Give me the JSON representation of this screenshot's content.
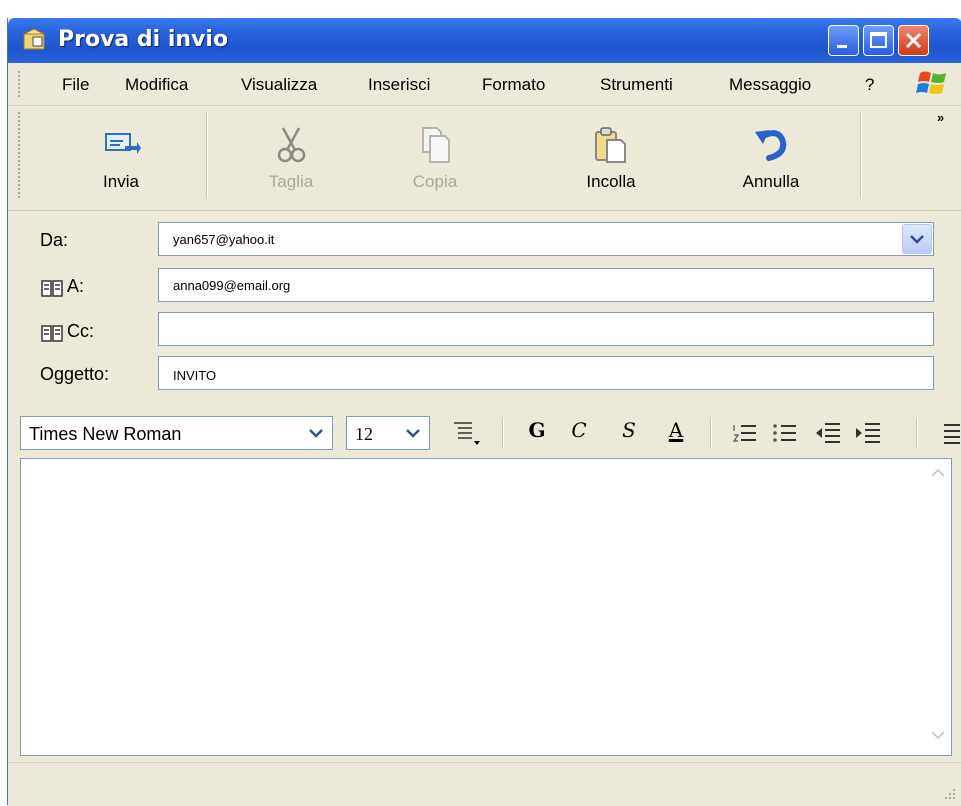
{
  "window": {
    "title": "Prova di invio"
  },
  "menubar": {
    "items": [
      "File",
      "Modifica",
      "Visualizza",
      "Inserisci",
      "Formato",
      "Strumenti",
      "Messaggio",
      "?"
    ]
  },
  "toolbar": {
    "overflow": "»",
    "buttons": [
      {
        "label": "Invia",
        "icon": "send-icon",
        "enabled": true
      },
      {
        "label": "Taglia",
        "icon": "scissors-icon",
        "enabled": false
      },
      {
        "label": "Copia",
        "icon": "copy-icon",
        "enabled": false
      },
      {
        "label": "Incolla",
        "icon": "paste-icon",
        "enabled": true
      },
      {
        "label": "Annulla",
        "icon": "undo-icon",
        "enabled": true
      }
    ]
  },
  "header": {
    "from_label": "Da:",
    "from_value": "yan657@yahoo.it",
    "to_label": "A:",
    "to_value": "anna099@email.org",
    "cc_label": "Cc:",
    "cc_value": "",
    "subject_label": "Oggetto:",
    "subject_value": "INVITO"
  },
  "format": {
    "font": "Times New Roman",
    "size": "12",
    "bold": "G",
    "italic": "C",
    "underline": "S",
    "font_color": "A"
  },
  "colors": {
    "titlebar": "#2a63db",
    "chrome": "#ece9d8",
    "field_border": "#7f9db9"
  }
}
